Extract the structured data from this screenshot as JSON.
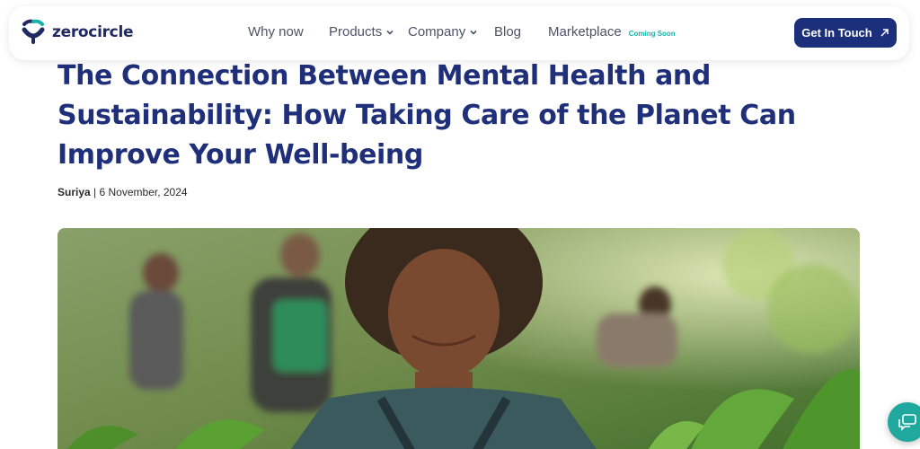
{
  "brand": {
    "name": "zerocircle"
  },
  "nav": {
    "items": [
      {
        "label": "Why now"
      },
      {
        "label": "Products"
      },
      {
        "label": "Company"
      },
      {
        "label": "Blog"
      },
      {
        "label": "Marketplace",
        "badge": "Coming Soon"
      }
    ],
    "cta_label": "Get In Touch"
  },
  "article": {
    "title": "The Connection Between Mental Health and Sustainability: How Taking Care of the Planet Can Improve Your Well-being",
    "author": "Suriya",
    "separator": "|",
    "date": "6 November, 2024"
  },
  "colors": {
    "brand_navy": "#1c2f7a",
    "accent_teal": "#18b3a8"
  },
  "icons": {
    "logo": "zerocircle-logo-icon",
    "chevron": "chevron-down-icon",
    "arrow": "arrow-up-right-icon",
    "chat": "chat-bubble-icon"
  }
}
